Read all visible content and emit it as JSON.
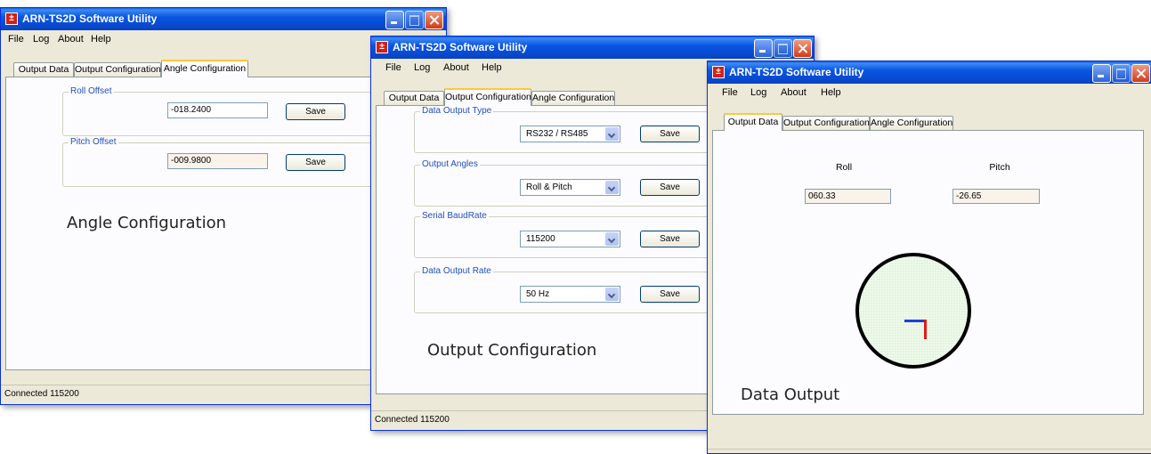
{
  "app_title": "ARN-TS2D Software Utility",
  "menu": [
    "File",
    "Log",
    "About",
    "Help"
  ],
  "tabs": [
    "Output Data",
    "Output Configuration",
    "Angle Configuration"
  ],
  "angle_config": {
    "roll_group": "Roll Offset",
    "roll_value": "-018.2400",
    "pitch_group": "Pitch Offset",
    "pitch_value": "-009.9800",
    "save_label": "Save",
    "caption": "Angle Configuration"
  },
  "output_config": {
    "groups": [
      {
        "label": "Data Output Type",
        "value": "RS232 / RS485"
      },
      {
        "label": "Output Angles",
        "value": "Roll & Pitch"
      },
      {
        "label": "Serial BaudRate",
        "value": "115200"
      },
      {
        "label": "Data Output Rate",
        "value": "50 Hz"
      }
    ],
    "save_label": "Save",
    "caption": "Output Configuration"
  },
  "data_output": {
    "roll_label": "Roll",
    "roll_value": "060.33",
    "pitch_label": "Pitch",
    "pitch_value": "-26.65",
    "caption": "Data Output"
  },
  "status": "Connected 115200",
  "colors": {
    "accent": "#0a55e3",
    "tab_highlight": "#ffc83c",
    "horizon_fill": "#e3f4df",
    "roll_line": "#1f3fd6",
    "pitch_line": "#e21a1a"
  }
}
